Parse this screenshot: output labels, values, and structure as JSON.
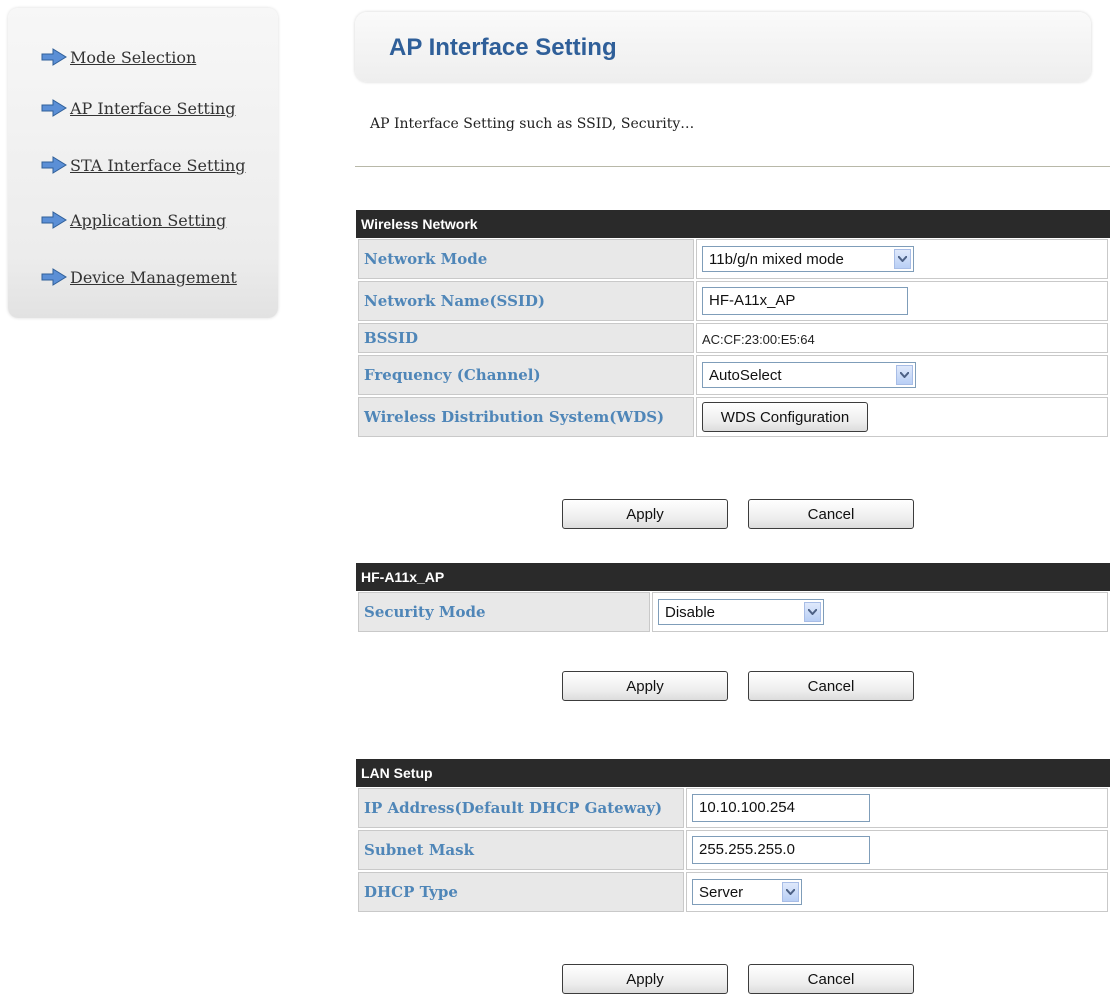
{
  "sidebar": {
    "items": [
      {
        "label": "Mode Selection",
        "icon": "arrow-right-icon"
      },
      {
        "label": "AP Interface Setting",
        "icon": "arrow-right-icon"
      },
      {
        "label": "STA Interface Setting",
        "icon": "arrow-right-icon"
      },
      {
        "label": "Application Setting",
        "icon": "arrow-right-icon"
      },
      {
        "label": "Device Management",
        "icon": "arrow-right-icon"
      }
    ]
  },
  "header": {
    "title": "AP Interface Setting",
    "description": "AP Interface Setting such as SSID, Security…"
  },
  "wireless": {
    "heading": "Wireless Network",
    "network_mode_label": "Network Mode",
    "network_mode_value": "11b/g/n mixed mode",
    "ssid_label": "Network Name(SSID)",
    "ssid_value": "HF-A11x_AP",
    "bssid_label": "BSSID",
    "bssid_value": "AC:CF:23:00:E5:64",
    "frequency_label": "Frequency (Channel)",
    "frequency_value": "AutoSelect",
    "wds_label": "Wireless Distribution System(WDS)",
    "wds_button": "WDS Configuration",
    "apply_label": "Apply",
    "cancel_label": "Cancel"
  },
  "security": {
    "heading": "HF-A11x_AP",
    "mode_label": "Security Mode",
    "mode_value": "Disable",
    "apply_label": "Apply",
    "cancel_label": "Cancel"
  },
  "lan": {
    "heading": "LAN Setup",
    "ip_label": "IP Address(Default DHCP Gateway)",
    "ip_value": "10.10.100.254",
    "subnet_label": "Subnet Mask",
    "subnet_value": "255.255.255.0",
    "dhcp_label": "DHCP Type",
    "dhcp_value": "Server",
    "apply_label": "Apply",
    "cancel_label": "Cancel"
  },
  "colors": {
    "label_text": "#4f86b8",
    "title_text": "#2f5f99",
    "section_header_bg": "#2a2a2a",
    "label_cell_bg": "#e8e8e8"
  }
}
